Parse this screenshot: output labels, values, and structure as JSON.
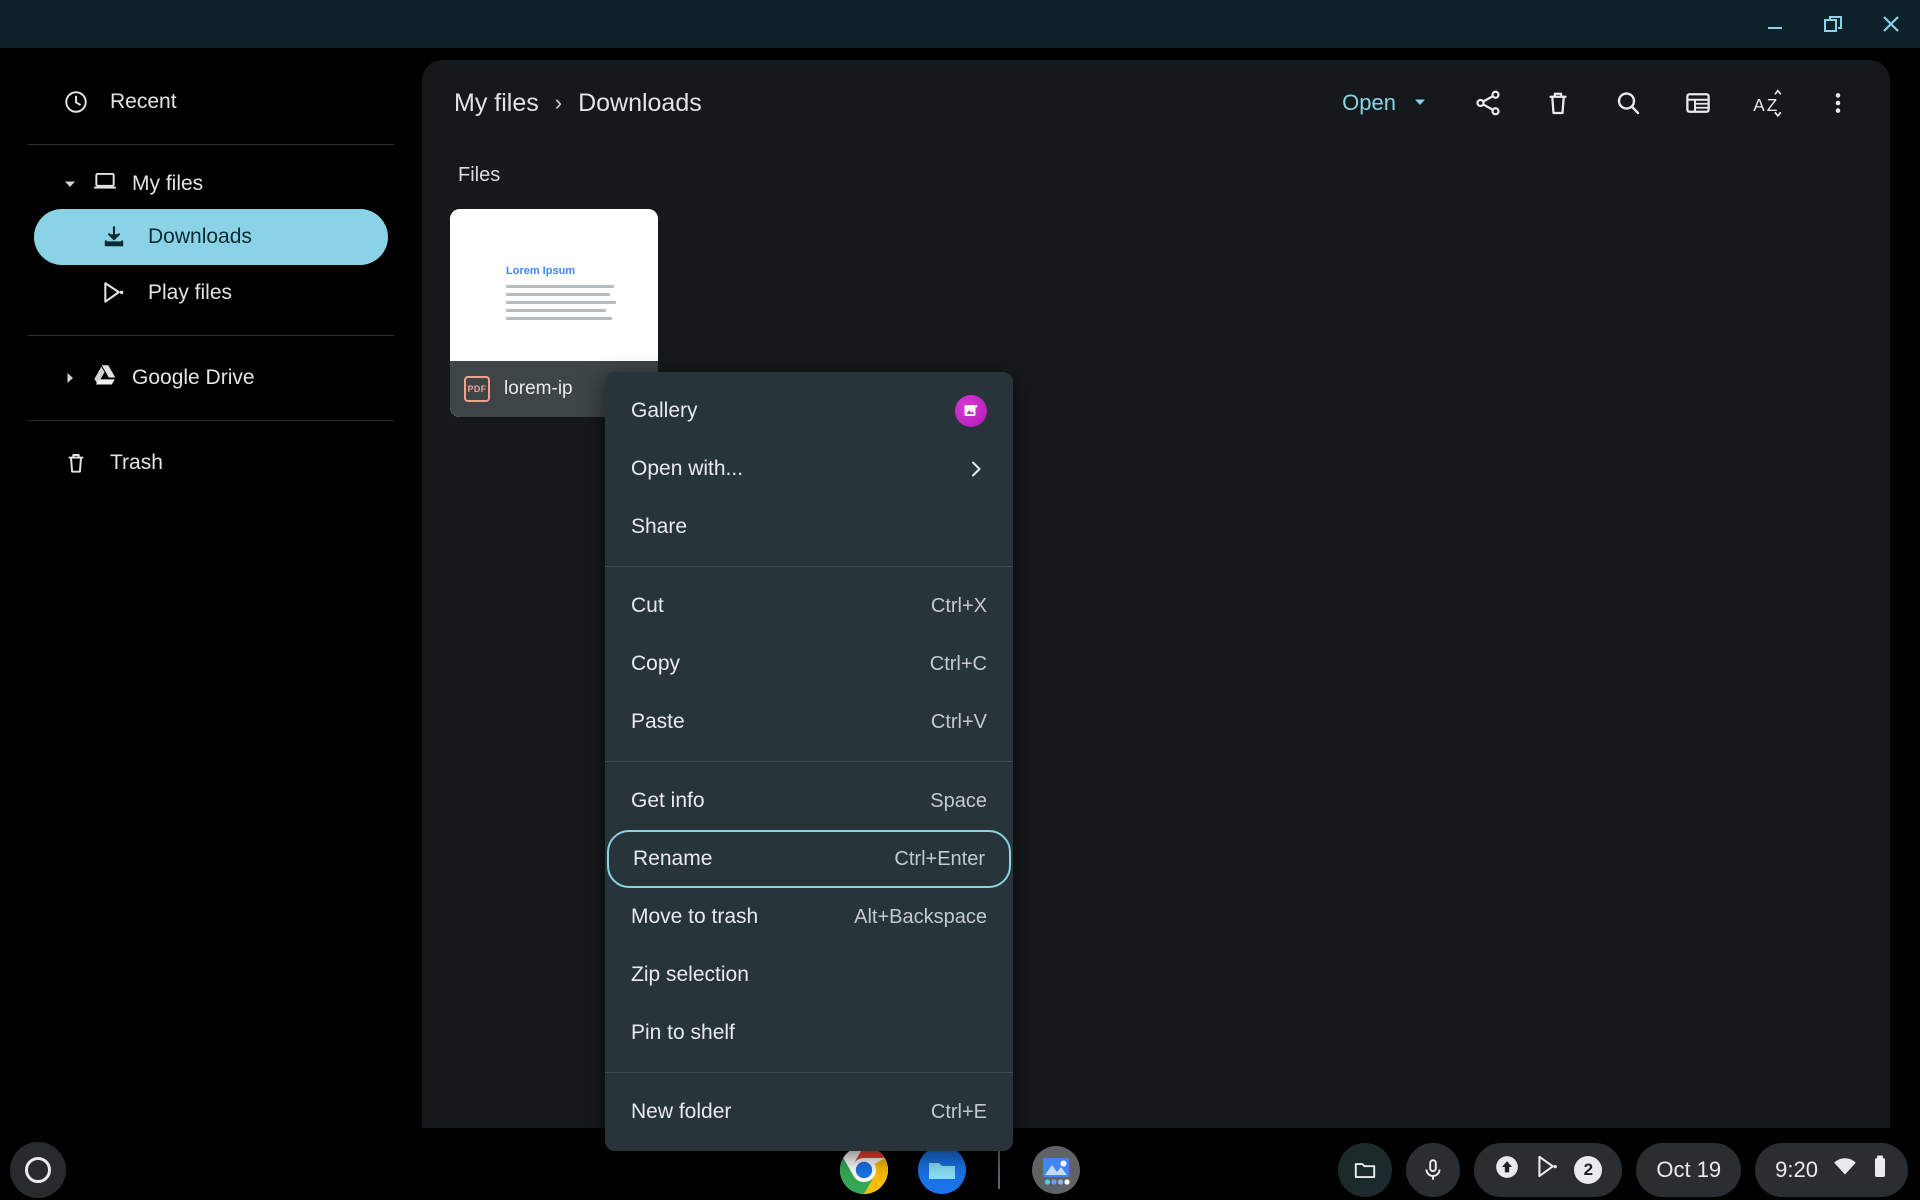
{
  "window": {
    "controls": [
      {
        "name": "minimize",
        "glyph": "minimize-icon"
      },
      {
        "name": "restore",
        "glyph": "restore-icon"
      },
      {
        "name": "close",
        "glyph": "close-icon"
      }
    ],
    "titlebar_color": "#0d2128",
    "control_color": "#8ad3e6"
  },
  "sidebar": {
    "recent": {
      "label": "Recent",
      "icon": "clock-icon"
    },
    "my_files": {
      "label": "My files",
      "icon": "laptop-icon",
      "expanded": true,
      "twisty": "chevron-down-icon"
    },
    "downloads": {
      "label": "Downloads",
      "icon": "download-icon",
      "selected": true
    },
    "play_files": {
      "label": "Play files",
      "icon": "play-store-icon"
    },
    "google_drive": {
      "label": "Google Drive",
      "icon": "google-drive-icon",
      "expanded": false,
      "twisty": "chevron-right-icon"
    },
    "trash": {
      "label": "Trash",
      "icon": "trash-icon"
    },
    "selected_color": "#8ad3e6"
  },
  "toolbar": {
    "breadcrumb": {
      "root": "My files",
      "separator": "›",
      "current": "Downloads"
    },
    "open_label": "Open",
    "open_caret": "caret-down-icon",
    "open_color": "#8ad3e6",
    "icons": [
      {
        "name": "share-icon",
        "title": "Share"
      },
      {
        "name": "trash-icon",
        "title": "Delete"
      },
      {
        "name": "search-icon",
        "title": "Search"
      },
      {
        "name": "list-view-icon",
        "title": "Toggle view"
      },
      {
        "name": "sort-az-icon",
        "title": "Sort"
      },
      {
        "name": "more-vertical-icon",
        "title": "More"
      }
    ]
  },
  "main": {
    "section_label": "Files",
    "files": [
      {
        "name": "lorem-ip",
        "type": "PDF",
        "badge_text": "PDF",
        "badge_color": "#f2a28c",
        "thumbnail": {
          "heading": "Lorem Ipsum",
          "heading_color": "#4285f4",
          "body_lines": 5
        }
      }
    ]
  },
  "context_menu": {
    "groups": [
      {
        "items": [
          {
            "label": "Gallery",
            "accel": "",
            "trailing": "gallery-app-icon",
            "focused": false
          },
          {
            "label": "Open with...",
            "accel": "",
            "trailing": "chevron-right-icon",
            "focused": false
          },
          {
            "label": "Share",
            "accel": "",
            "trailing": "",
            "focused": false
          }
        ]
      },
      {
        "items": [
          {
            "label": "Cut",
            "accel": "Ctrl+X",
            "trailing": "",
            "focused": false
          },
          {
            "label": "Copy",
            "accel": "Ctrl+C",
            "trailing": "",
            "focused": false
          },
          {
            "label": "Paste",
            "accel": "Ctrl+V",
            "trailing": "",
            "focused": false
          }
        ]
      },
      {
        "items": [
          {
            "label": "Get info",
            "accel": "Space",
            "trailing": "",
            "focused": false
          },
          {
            "label": "Rename",
            "accel": "Ctrl+Enter",
            "trailing": "",
            "focused": true
          },
          {
            "label": "Move to trash",
            "accel": "Alt+Backspace",
            "trailing": "",
            "focused": false
          },
          {
            "label": "Zip selection",
            "accel": "",
            "trailing": "",
            "focused": false
          },
          {
            "label": "Pin to shelf",
            "accel": "",
            "trailing": "",
            "focused": false
          }
        ]
      },
      {
        "items": [
          {
            "label": "New folder",
            "accel": "Ctrl+E",
            "trailing": "",
            "focused": false
          }
        ]
      }
    ],
    "focus_ring_color": "#8ad3e6",
    "background": "#27343a"
  },
  "shelf": {
    "launcher": {
      "name": "launcher-button"
    },
    "apps": [
      {
        "name": "chrome-icon",
        "label": "Chrome",
        "running": true
      },
      {
        "name": "files-icon",
        "label": "Files",
        "running": true
      },
      {
        "name": "gallery-icon",
        "label": "Gallery",
        "running": true
      }
    ],
    "status": {
      "tote": "tote-folder-icon",
      "mic": "microphone-icon",
      "tray_icons": [
        "system-update-icon",
        "play-store-icon"
      ],
      "notification_count": "2",
      "date": "Oct 19",
      "time": "9:20",
      "network": "wifi-icon",
      "battery": "battery-icon"
    }
  }
}
